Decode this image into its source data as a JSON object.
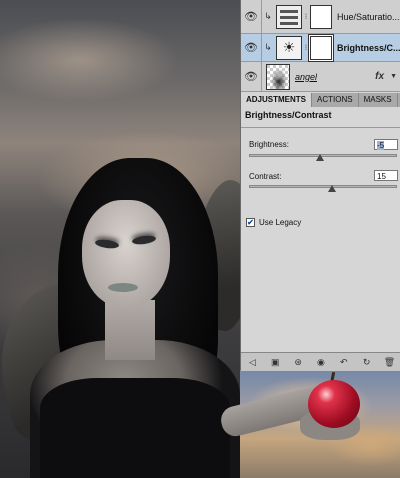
{
  "layers_panel": {
    "layers": [
      {
        "name": "Hue/Saturatio...",
        "icon": "hue-saturation-adjustment-icon",
        "selected": false
      },
      {
        "name": "Brightness/C...",
        "icon": "brightness-contrast-adjustment-icon",
        "selected": true
      },
      {
        "name": "angel",
        "icon": "image-layer-thumbnail",
        "selected": false
      }
    ],
    "fx_label": "fx"
  },
  "adjustments_panel": {
    "tabs": [
      "ADJUSTMENTS",
      "ACTIONS",
      "MASKS"
    ],
    "active_tab": "ADJUSTMENTS",
    "title": "Brightness/Contrast",
    "brightness": {
      "label": "Brightness:",
      "value": "-5",
      "slider_fraction": 0.48
    },
    "contrast": {
      "label": "Contrast:",
      "value": "15",
      "slider_fraction": 0.56
    },
    "use_legacy": {
      "label": "Use Legacy",
      "checked": true
    }
  },
  "bottom_bar_icons": [
    "back-arrow-icon",
    "clip-panel-icon",
    "layer-visibility-icon",
    "eye-icon",
    "reset-icon",
    "refresh-icon",
    "trash-icon"
  ],
  "colors": {
    "selection": "#b7cde3",
    "panel": "#d6d6d6"
  }
}
